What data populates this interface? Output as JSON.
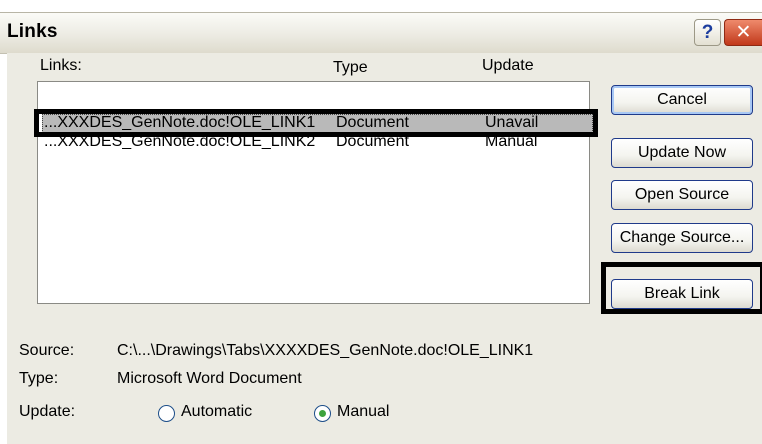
{
  "window": {
    "title": "Links",
    "help_glyph": "?",
    "close_glyph": "✕"
  },
  "list": {
    "headers": {
      "links": "Links:",
      "type": "Type",
      "update": "Update"
    },
    "rows": [
      {
        "link": "...XXXDES_GenNote.doc!OLE_LINK1",
        "type": "Document",
        "update": "Unavail"
      },
      {
        "link": "...XXXDES_GenNote.doc!OLE_LINK2",
        "type": "Document",
        "update": "Manual"
      }
    ]
  },
  "buttons": {
    "cancel": "Cancel",
    "update_now": "Update Now",
    "open_source": "Open Source",
    "change_source": "Change Source...",
    "break_link": "Break Link"
  },
  "details": {
    "source_label": "Source:",
    "source_value": "C:\\...\\Drawings\\Tabs\\XXXXDES_GenNote.doc!OLE_LINK1",
    "type_label": "Type:",
    "type_value": "Microsoft Word Document",
    "update_label": "Update:",
    "automatic_label": "Automatic",
    "manual_label": "Manual",
    "selected_update": "Manual"
  },
  "colors": {
    "dialog_bg": "#ecebe3",
    "selection": "#b9b9b9",
    "button_border": "#1f3a8a",
    "radio_checked": "#3da33d",
    "close_button": "#c1391b"
  }
}
